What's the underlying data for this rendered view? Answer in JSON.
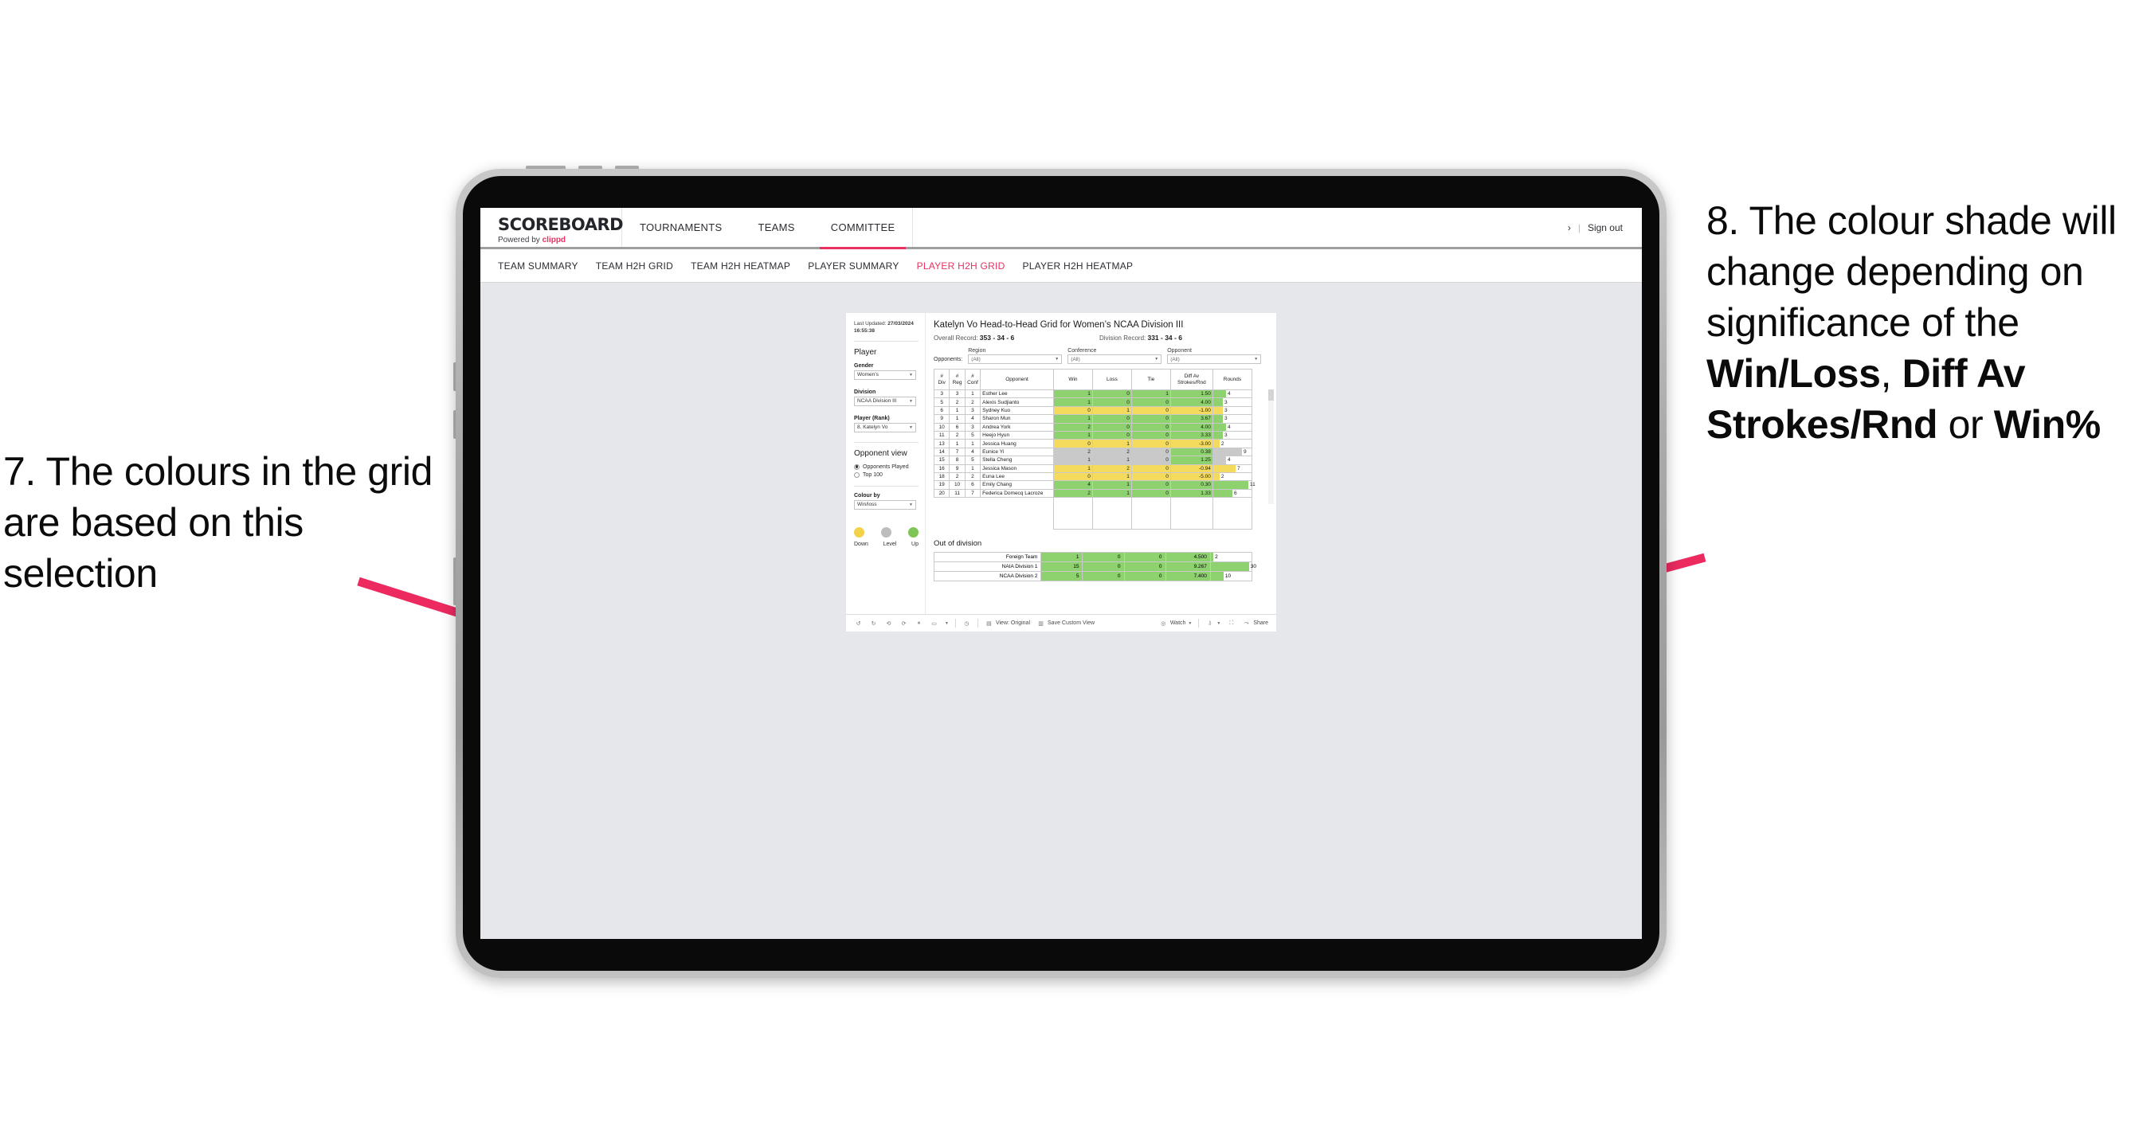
{
  "annotations": {
    "left": "7. The colours in the grid are based on this selection",
    "right_parts": [
      {
        "text": "8. The colour shade will change depending on significance of the ",
        "bold": false
      },
      {
        "text": "Win/Loss",
        "bold": true
      },
      {
        "text": ", ",
        "bold": false
      },
      {
        "text": "Diff Av Strokes/Rnd",
        "bold": true
      },
      {
        "text": " or ",
        "bold": false
      },
      {
        "text": "Win%",
        "bold": true
      }
    ],
    "arrow_color": "#ec2a60"
  },
  "brand": {
    "title": "SCOREBOARD",
    "powered_prefix": "Powered by ",
    "powered_name": "clippd"
  },
  "topnav": {
    "items": [
      {
        "label": "TOURNAMENTS",
        "active": false
      },
      {
        "label": "TEAMS",
        "active": false
      },
      {
        "label": "COMMITTEE",
        "active": true
      }
    ],
    "chevron": "›",
    "separator": "|",
    "signout": "Sign out"
  },
  "subnav": {
    "items": [
      {
        "label": "TEAM SUMMARY",
        "active": false
      },
      {
        "label": "TEAM H2H GRID",
        "active": false
      },
      {
        "label": "TEAM H2H HEATMAP",
        "active": false
      },
      {
        "label": "PLAYER SUMMARY",
        "active": false
      },
      {
        "label": "PLAYER H2H GRID",
        "active": true
      },
      {
        "label": "PLAYER H2H HEATMAP",
        "active": false
      }
    ]
  },
  "sidebar": {
    "last_updated_label": "Last Updated: ",
    "last_updated_value": "27/03/2024 16:55:38",
    "player_heading": "Player",
    "gender_label": "Gender",
    "gender_value": "Women’s",
    "division_label": "Division",
    "division_value": "NCAA Division III",
    "player_rank_label": "Player (Rank)",
    "player_rank_value": "8. Katelyn Vo",
    "opponent_view_heading": "Opponent view",
    "opponent_view_options": [
      {
        "label": "Opponents Played",
        "selected": true
      },
      {
        "label": "Top 100",
        "selected": false
      }
    ],
    "colour_by_label": "Colour by",
    "colour_by_value": "Win/loss",
    "legend": [
      {
        "label": "Down",
        "color": "#f2d24b"
      },
      {
        "label": "Level",
        "color": "#bdbdbd"
      },
      {
        "label": "Up",
        "color": "#7ec457"
      }
    ]
  },
  "main": {
    "title": "Katelyn Vo Head-to-Head Grid for Women’s NCAA Division III",
    "overall_record_label": "Overall Record: ",
    "overall_record_value": "353 - 34 - 6",
    "division_record_label": "Division Record: ",
    "division_record_value": "331 - 34 - 6",
    "opponents_label": "Opponents:",
    "filters": [
      {
        "label": "Region",
        "value": "(All)"
      },
      {
        "label": "Conference",
        "value": "(All)"
      },
      {
        "label": "Opponent",
        "value": "(All)"
      }
    ],
    "out_of_division_title": "Out of division"
  },
  "chart_data": {
    "type": "table",
    "title": "Katelyn Vo Head-to-Head Grid for Women’s NCAA Division III",
    "columns": [
      "# Div",
      "# Reg",
      "# Conf",
      "Opponent",
      "Win",
      "Loss",
      "Tie",
      "Diff Av Strokes/Rnd",
      "Rounds"
    ],
    "colour_by": "Win/loss",
    "colour_scale": {
      "up": "#8ed16f",
      "level": "#c9c9c9",
      "down": "#f4db5e"
    },
    "rounds_max": 12,
    "rows": [
      {
        "div": "3",
        "reg": "3",
        "conf": "1",
        "opponent": "Esther Lee",
        "win": "1",
        "loss": "0",
        "tie": "1",
        "diff": "1.50",
        "rounds": 4,
        "state": "up",
        "diff_state": "up"
      },
      {
        "div": "5",
        "reg": "2",
        "conf": "2",
        "opponent": "Alexis Sudjianto",
        "win": "1",
        "loss": "0",
        "tie": "0",
        "diff": "4.00",
        "rounds": 3,
        "state": "up",
        "diff_state": "up"
      },
      {
        "div": "6",
        "reg": "1",
        "conf": "3",
        "opponent": "Sydney Kuo",
        "win": "0",
        "loss": "1",
        "tie": "0",
        "diff": "-1.00",
        "rounds": 3,
        "state": "down",
        "diff_state": "down"
      },
      {
        "div": "9",
        "reg": "1",
        "conf": "4",
        "opponent": "Sharon Mun",
        "win": "1",
        "loss": "0",
        "tie": "0",
        "diff": "3.67",
        "rounds": 3,
        "state": "up",
        "diff_state": "up"
      },
      {
        "div": "10",
        "reg": "6",
        "conf": "3",
        "opponent": "Andrea York",
        "win": "2",
        "loss": "0",
        "tie": "0",
        "diff": "4.00",
        "rounds": 4,
        "state": "up",
        "diff_state": "up"
      },
      {
        "div": "11",
        "reg": "2",
        "conf": "5",
        "opponent": "Heejo Hyun",
        "win": "1",
        "loss": "0",
        "tie": "0",
        "diff": "3.33",
        "rounds": 3,
        "state": "up",
        "diff_state": "up"
      },
      {
        "div": "13",
        "reg": "1",
        "conf": "1",
        "opponent": "Jessica Huang",
        "win": "0",
        "loss": "1",
        "tie": "0",
        "diff": "-3.00",
        "rounds": 2,
        "state": "down",
        "diff_state": "down"
      },
      {
        "div": "14",
        "reg": "7",
        "conf": "4",
        "opponent": "Eunice Yi",
        "win": "2",
        "loss": "2",
        "tie": "0",
        "diff": "0.38",
        "rounds": 9,
        "state": "level",
        "diff_state": "up"
      },
      {
        "div": "15",
        "reg": "8",
        "conf": "5",
        "opponent": "Stella Cheng",
        "win": "1",
        "loss": "1",
        "tie": "0",
        "diff": "1.25",
        "rounds": 4,
        "state": "level",
        "diff_state": "up"
      },
      {
        "div": "16",
        "reg": "9",
        "conf": "1",
        "opponent": "Jessica Mason",
        "win": "1",
        "loss": "2",
        "tie": "0",
        "diff": "-0.94",
        "rounds": 7,
        "state": "down",
        "diff_state": "down"
      },
      {
        "div": "18",
        "reg": "2",
        "conf": "2",
        "opponent": "Euna Lee",
        "win": "0",
        "loss": "1",
        "tie": "0",
        "diff": "-5.00",
        "rounds": 2,
        "state": "down",
        "diff_state": "down"
      },
      {
        "div": "19",
        "reg": "10",
        "conf": "6",
        "opponent": "Emily Chang",
        "win": "4",
        "loss": "1",
        "tie": "0",
        "diff": "0.30",
        "rounds": 11,
        "state": "up",
        "diff_state": "up"
      },
      {
        "div": "20",
        "reg": "11",
        "conf": "7",
        "opponent": "Federica Domecq Lacroze",
        "win": "2",
        "loss": "1",
        "tie": "0",
        "diff": "1.33",
        "rounds": 6,
        "state": "up",
        "diff_state": "up"
      }
    ],
    "out_of_division": {
      "rounds_max": 32,
      "rows": [
        {
          "name": "Foreign Team",
          "win": "1",
          "loss": "0",
          "tie": "0",
          "diff": "4.500",
          "rounds": 2,
          "state": "up"
        },
        {
          "name": "NAIA Division 1",
          "win": "15",
          "loss": "0",
          "tie": "0",
          "diff": "9.267",
          "rounds": 30,
          "state": "up"
        },
        {
          "name": "NCAA Division 2",
          "win": "5",
          "loss": "0",
          "tie": "0",
          "diff": "7.400",
          "rounds": 10,
          "state": "up"
        }
      ]
    }
  },
  "toolbar": {
    "undo_icon": "undo-icon",
    "redo_icon": "redo-icon",
    "revert_icon": "revert-icon",
    "refresh_icon": "refresh-data-icon",
    "pause_icon": "pause-updates-icon",
    "highlight_icon": "highlight-icon",
    "alert_icon": "alerts-icon",
    "view_label": "View: Original",
    "save_label": "Save Custom View",
    "watch_label": "Watch",
    "download_icon": "download-icon",
    "fullscreen_icon": "fullscreen-icon",
    "share_label": "Share"
  }
}
